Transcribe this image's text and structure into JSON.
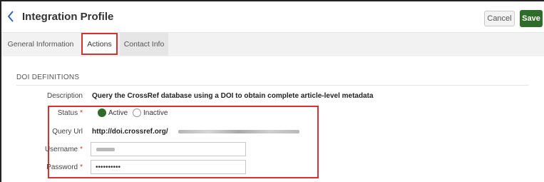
{
  "header": {
    "title": "Integration Profile",
    "cancel_label": "Cancel",
    "save_label": "Save",
    "back_icon": "chevron-left-icon"
  },
  "tabs": [
    {
      "label": "General Information",
      "selected": false
    },
    {
      "label": "Actions",
      "selected": true
    },
    {
      "label": "Contact Info",
      "selected": false
    }
  ],
  "section": {
    "title": "DOI DEFINITIONS"
  },
  "fields": {
    "description_label": "Description",
    "description_value": "Query the CrossRef database using a DOI to obtain complete article-level metadata",
    "status_label": "Status",
    "status_active": "Active",
    "status_inactive": "Inactive",
    "status_selected": "Active",
    "query_url_label": "Query Url",
    "query_url_value": "http://doi.crossref.org/",
    "username_label": "Username",
    "password_label": "Password",
    "password_value": "••••••••••",
    "required_mark": "*"
  },
  "colors": {
    "accent": "#2f6b2a",
    "highlight": "#d93030"
  }
}
